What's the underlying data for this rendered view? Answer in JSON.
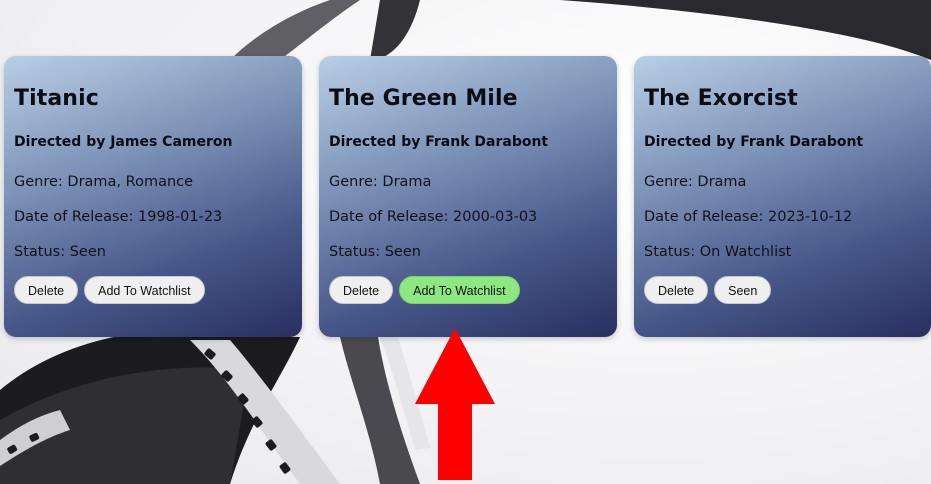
{
  "movies": [
    {
      "title": "Titanic",
      "director": "Directed by James Cameron",
      "genre": "Genre: Drama, Romance",
      "release": "Date of Release: 1998-01-23",
      "status": "Status: Seen",
      "buttons": [
        "Delete",
        "Add To Watchlist"
      ]
    },
    {
      "title": "The Green Mile",
      "director": "Directed by Frank Darabont",
      "genre": "Genre: Drama",
      "release": "Date of Release: 2000-03-03",
      "status": "Status: Seen",
      "buttons": [
        "Delete",
        "Add To Watchlist"
      ]
    },
    {
      "title": "The Exorcist",
      "director": "Directed by Frank Darabont",
      "genre": "Genre: Drama",
      "release": "Date of Release: 2023-10-12",
      "status": "Status: On Watchlist",
      "buttons": [
        "Delete",
        "Seen"
      ]
    }
  ],
  "colors": {
    "highlight_button": "#8ee882",
    "annotation_arrow": "#ff0000",
    "card_top": "#b9cfe6",
    "card_bottom": "#28305f"
  },
  "annotation": {
    "icon": "red-arrow-up-icon"
  }
}
